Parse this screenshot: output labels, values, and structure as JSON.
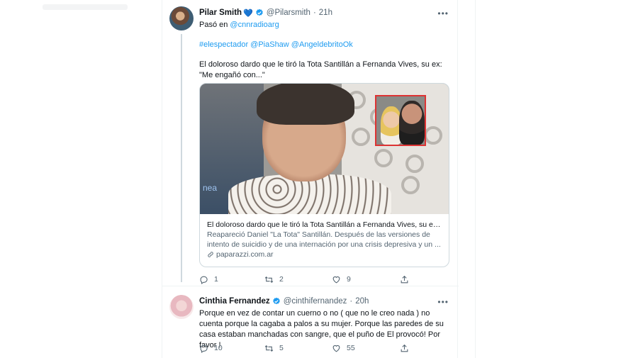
{
  "tweets": [
    {
      "name": "Pilar Smith",
      "name_emoji": "💙",
      "handle": "@Pilarsmith",
      "separator": "·",
      "time": "21h",
      "more": "•••",
      "line1_prefix": "Pasó en ",
      "line1_mention": "@cnnradioarg",
      "hashtags": "#elespectador @PiaShaw @AngeldebritoOk",
      "body": "El doloroso dardo que le tiró la Tota Santillán a Fernanda Vives, su ex: \"Me engañó con...\"",
      "card": {
        "image_text": "nea",
        "title": "El doloroso dardo que le tiró la Tota Santillán a Fernanda Vives, su ex: ...",
        "description": "Reapareció Daniel \"La Tota\" Santillán. Después de las versiones de intento de suicidio y de una internación por una crisis depresiva y un ...",
        "domain": "paparazzi.com.ar"
      },
      "replies": "1",
      "retweets": "2",
      "likes": "9"
    },
    {
      "name": "Cinthia Fernandez",
      "handle": "@cinthifernandez",
      "separator": "·",
      "time": "20h",
      "more": "•••",
      "body": "Porque en vez  de contar un cuerno o no ( que no le creo nada ) no cuenta porque la cagaba a palos a su mujer. Porque las paredes de su casa estaban manchadas con sangre, que el puño de El provocó! Por favor !",
      "replies": "10",
      "retweets": "5",
      "likes": "55"
    }
  ],
  "icons": {
    "verified": "verified-badge-icon",
    "reply": "reply-icon",
    "retweet": "retweet-icon",
    "like": "heart-icon",
    "share": "share-icon",
    "link": "link-icon"
  },
  "colors": {
    "accent": "#1d9bf0",
    "muted": "#536471",
    "border": "#eff3f4"
  }
}
